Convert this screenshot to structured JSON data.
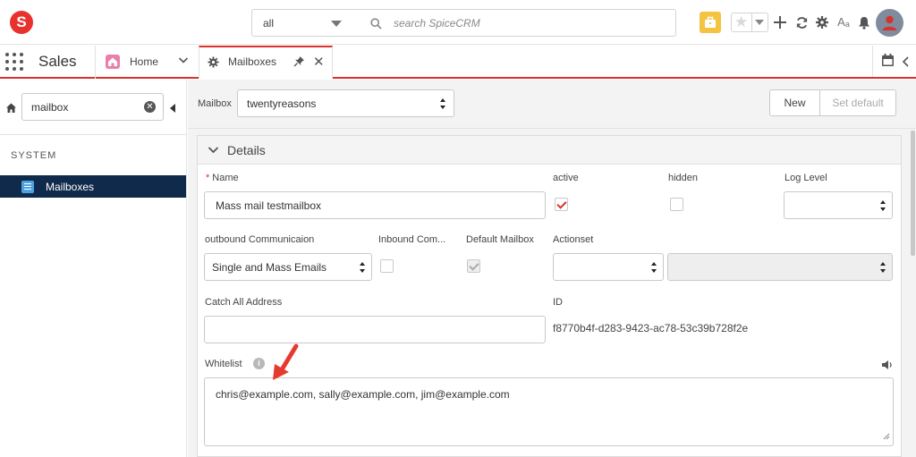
{
  "topbar": {
    "logo_letter": "S",
    "search_scope": "all",
    "search_placeholder": "search SpiceCRM",
    "brand_color": "#e8322e",
    "icons": [
      "briefcase-icon",
      "star-icon",
      "plus-icon",
      "refresh-icon",
      "gear-icon",
      "font-size-icon",
      "bell-icon",
      "user-avatar-icon"
    ]
  },
  "tabbar": {
    "app_name": "Sales",
    "tabs": [
      {
        "label": "Home",
        "icon": "home-icon"
      },
      {
        "label": "Mailboxes",
        "icon": "gear-icon",
        "active": true
      }
    ],
    "accent_color": "#d8322d"
  },
  "sidebar": {
    "search_value": "mailbox",
    "section_heading": "SYSTEM",
    "items": [
      {
        "label": "Mailboxes",
        "selected": true
      }
    ],
    "selected_color": "#0f2a4a"
  },
  "main": {
    "mailbox_label": "Mailbox",
    "mailbox_value": "twentyreasons",
    "buttons": {
      "new": "New",
      "set_default": "Set default"
    }
  },
  "details": {
    "title": "Details",
    "fields": {
      "name": {
        "label": "Name",
        "value": "Mass mail testmailbox",
        "required": true
      },
      "active": {
        "label": "active",
        "checked": true
      },
      "hidden": {
        "label": "hidden",
        "checked": false
      },
      "log_level": {
        "label": "Log Level",
        "value": ""
      },
      "outbound": {
        "label": "outbound Communicaion",
        "value": "Single and Mass Emails"
      },
      "inbound": {
        "label": "Inbound Com...",
        "checked": false
      },
      "default_mailbox": {
        "label": "Default Mailbox",
        "checked": true,
        "disabled": true
      },
      "actionset": {
        "label": "Actionset",
        "value": "",
        "second_value": ""
      },
      "catch_all": {
        "label": "Catch All Address",
        "value": ""
      },
      "id": {
        "label": "ID",
        "value": "f8770b4f-d283-9423-ac78-53c39b728f2e"
      },
      "whitelist": {
        "label": "Whitelist",
        "value": "chris@example.com, sally@example.com, jim@example.com"
      }
    }
  }
}
